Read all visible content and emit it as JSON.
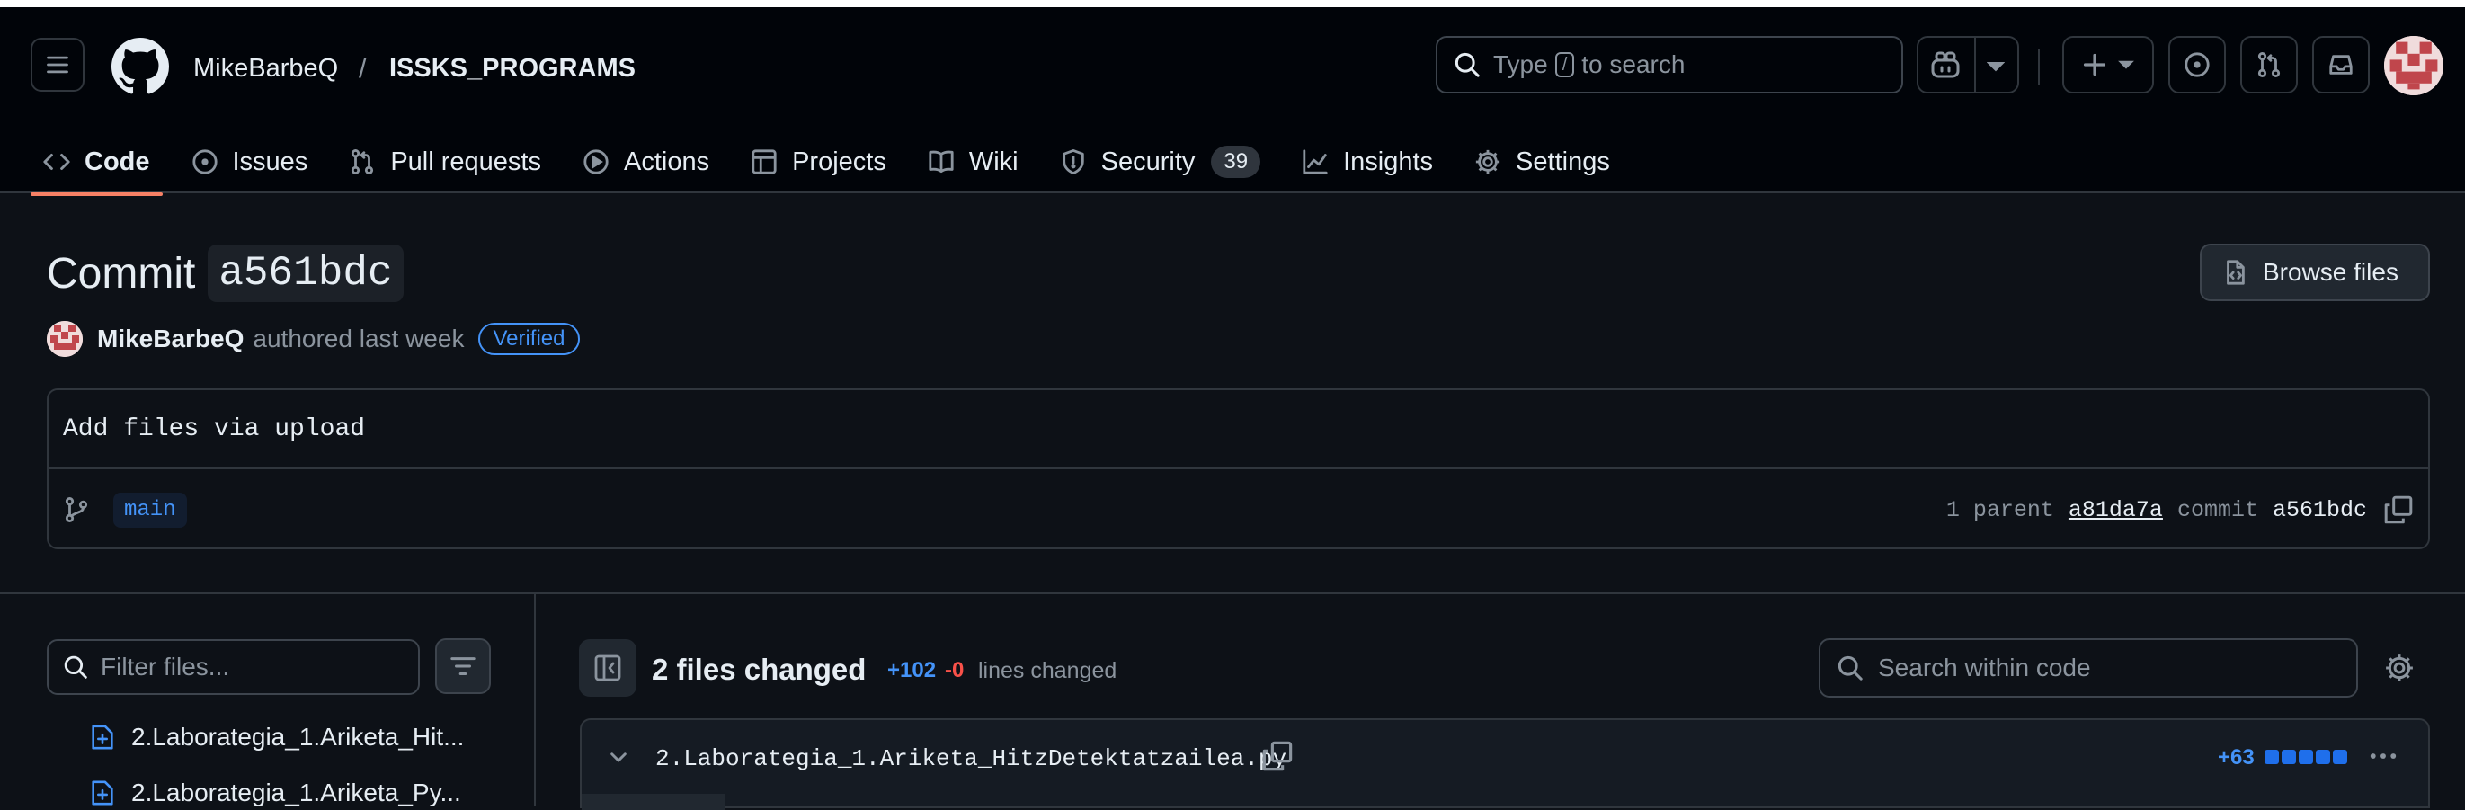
{
  "header": {
    "owner": "MikeBarbeQ",
    "separator": "/",
    "repo": "ISSKS_PROGRAMS",
    "search": {
      "prefix": "Type",
      "key": "/",
      "suffix": "to search"
    }
  },
  "tabs": [
    {
      "label": "Code",
      "icon": "code-icon",
      "active": true
    },
    {
      "label": "Issues",
      "icon": "issue-icon"
    },
    {
      "label": "Pull requests",
      "icon": "pull-request-icon"
    },
    {
      "label": "Actions",
      "icon": "play-icon"
    },
    {
      "label": "Projects",
      "icon": "table-icon"
    },
    {
      "label": "Wiki",
      "icon": "book-icon"
    },
    {
      "label": "Security",
      "icon": "shield-icon",
      "count": "39"
    },
    {
      "label": "Insights",
      "icon": "graph-icon"
    },
    {
      "label": "Settings",
      "icon": "gear-icon"
    }
  ],
  "commit": {
    "title_prefix": "Commit",
    "sha": "a561bdc",
    "browse_label": "Browse files",
    "author": "MikeBarbeQ",
    "meta": "authored last week",
    "verified": "Verified",
    "message": "Add files via upload",
    "branch": "main",
    "parent_label": "1 parent",
    "parent_sha": "a81da7a",
    "commit_label": "commit",
    "commit_sha": "a561bdc"
  },
  "files_panel": {
    "filter_placeholder": "Filter files...",
    "items": [
      "2.Laborategia_1.Ariketa_Hit...",
      "2.Laborategia_1.Ariketa_Py..."
    ]
  },
  "diff": {
    "title": "2 files changed",
    "additions": "+102",
    "deletions": "-0",
    "lines_label": "lines changed",
    "search_placeholder": "Search within code",
    "file": {
      "name": "2.Laborategia_1.Ariketa_HitzDetektatzailea.py",
      "additions": "+63"
    }
  },
  "colors": {
    "accent": "#f78166",
    "link": "#4493f8",
    "danger": "#f85149",
    "bg": "#0d1117"
  }
}
